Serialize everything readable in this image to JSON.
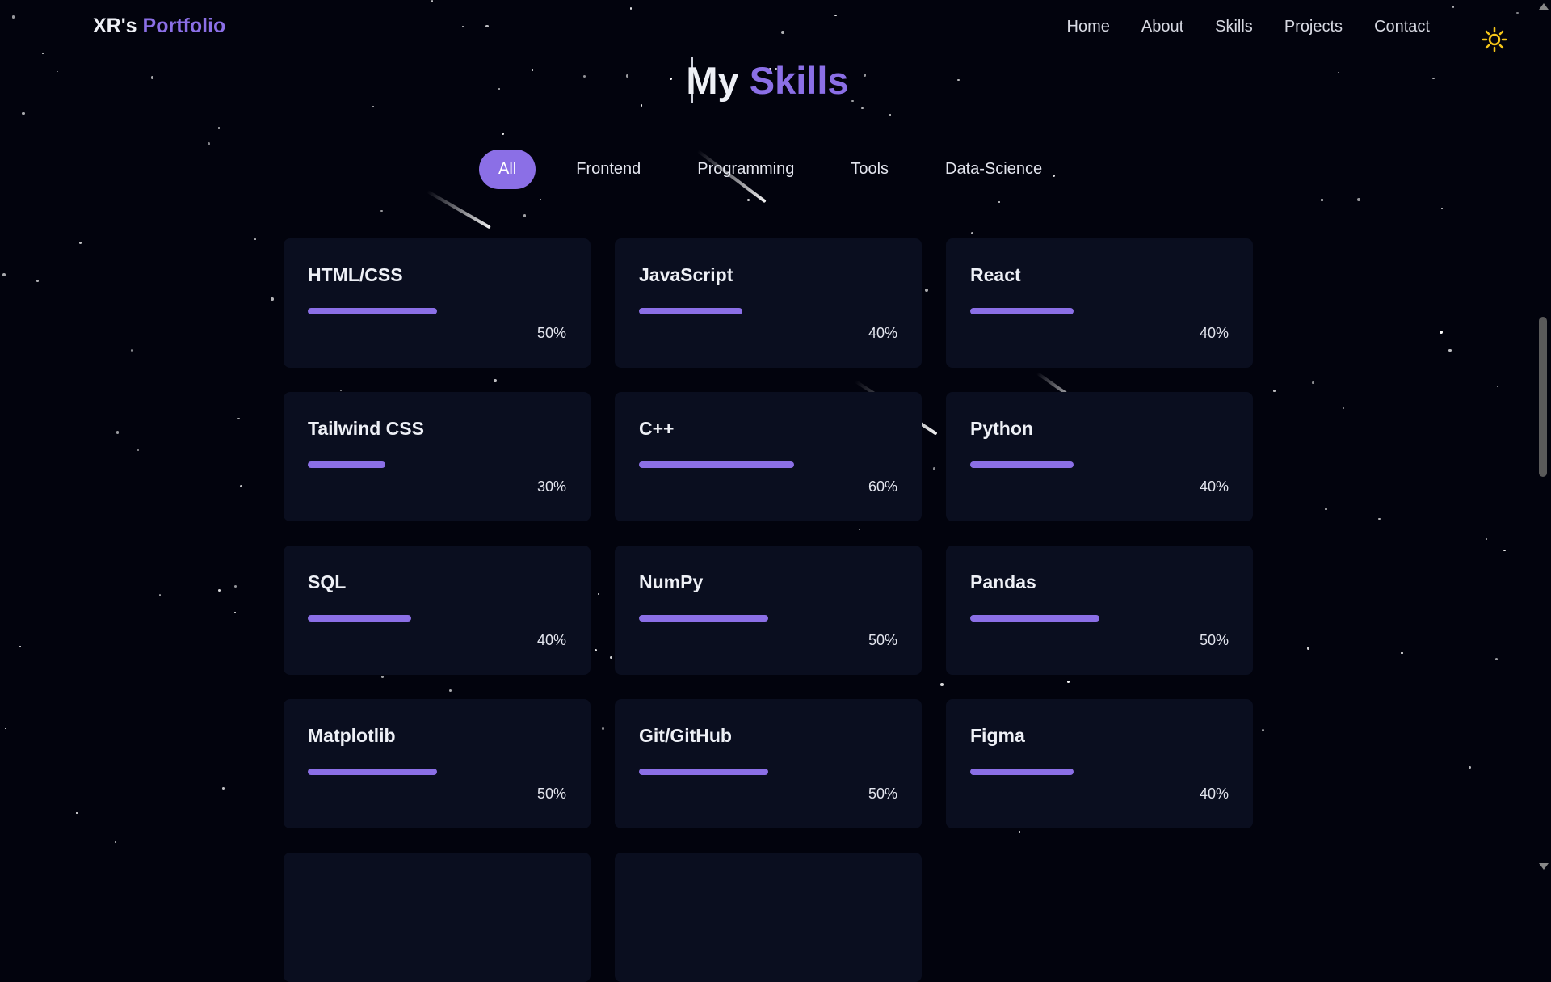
{
  "nav": {
    "logo_prefix": "XR's",
    "logo_accent": "Portfolio",
    "links": [
      "Home",
      "About",
      "Skills",
      "Projects",
      "Contact"
    ],
    "theme_icon": "sun-icon"
  },
  "section": {
    "title_prefix": "My",
    "title_accent": "Skills"
  },
  "tabs": [
    {
      "label": "All",
      "active": true
    },
    {
      "label": "Frontend",
      "active": false
    },
    {
      "label": "Programming",
      "active": false
    },
    {
      "label": "Tools",
      "active": false
    },
    {
      "label": "Data-Science",
      "active": false
    }
  ],
  "skills": [
    {
      "name": "HTML/CSS",
      "percent_label": "50%",
      "level": 0.5
    },
    {
      "name": "JavaScript",
      "percent_label": "40%",
      "level": 0.4
    },
    {
      "name": "React",
      "percent_label": "40%",
      "level": 0.4
    },
    {
      "name": "Tailwind CSS",
      "percent_label": "30%",
      "level": 0.3
    },
    {
      "name": "C++",
      "percent_label": "60%",
      "level": 0.6
    },
    {
      "name": "Python",
      "percent_label": "40%",
      "level": 0.4
    },
    {
      "name": "SQL",
      "percent_label": "40%",
      "level": 0.4
    },
    {
      "name": "NumPy",
      "percent_label": "50%",
      "level": 0.5
    },
    {
      "name": "Pandas",
      "percent_label": "50%",
      "level": 0.5
    },
    {
      "name": "Matplotlib",
      "percent_label": "50%",
      "level": 0.5
    },
    {
      "name": "Git/GitHub",
      "percent_label": "50%",
      "level": 0.5
    },
    {
      "name": "Figma",
      "percent_label": "40%",
      "level": 0.4
    }
  ],
  "colors": {
    "accent": "#8b6fe6",
    "background": "#02030d",
    "card": "#0a0e1f",
    "sun": "#f5c518"
  }
}
